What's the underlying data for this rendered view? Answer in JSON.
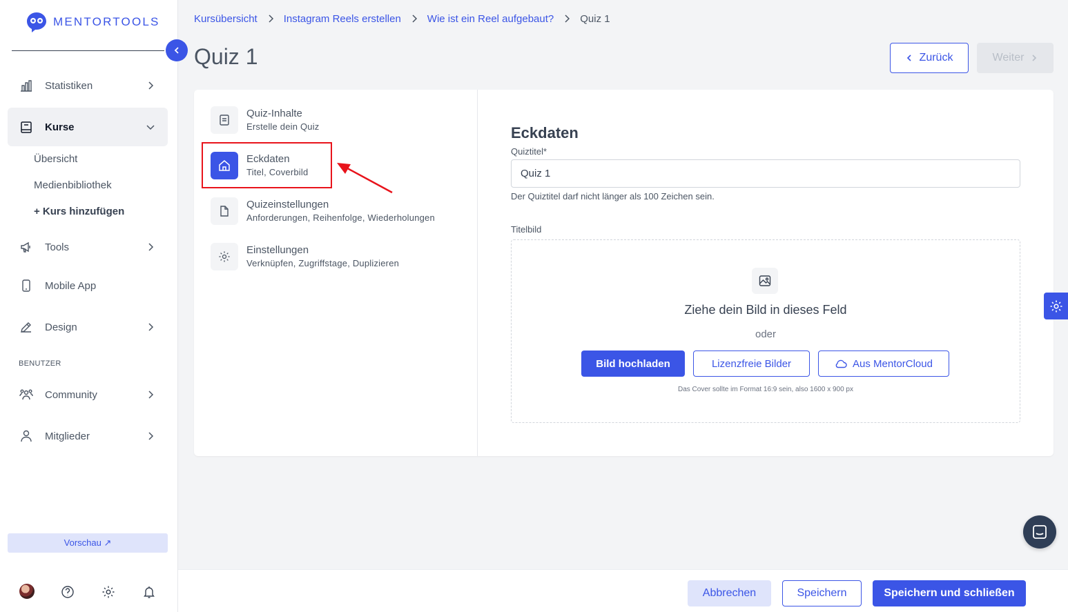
{
  "brand": {
    "name": "MENTORTOOLS",
    "accent": "#3b55e6"
  },
  "sidebar": {
    "nav": [
      {
        "label": "Statistiken",
        "icon": "bar-chart-icon"
      },
      {
        "label": "Kurse",
        "icon": "book-icon",
        "active": true
      },
      {
        "label": "Tools",
        "icon": "megaphone-icon"
      },
      {
        "label": "Mobile App",
        "icon": "phone-icon"
      },
      {
        "label": "Design",
        "icon": "pencil-icon"
      },
      {
        "label": "Community",
        "icon": "users-icon"
      },
      {
        "label": "Mitglieder",
        "icon": "user-icon"
      }
    ],
    "kurse_sub": [
      "Übersicht",
      "Medienbibliothek",
      "+ Kurs hinzufügen"
    ],
    "section_label": "BENUTZER",
    "preview_label": "Vorschau ↗"
  },
  "breadcrumb": [
    "Kursübersicht",
    "Instagram Reels erstellen",
    "Wie ist ein Reel aufgebaut?",
    "Quiz 1"
  ],
  "page_title": "Quiz 1",
  "nav_buttons": {
    "back": "Zurück",
    "next": "Weiter"
  },
  "steps": [
    {
      "title": "Quiz-Inhalte",
      "subtitle": "Erstelle dein Quiz",
      "icon": "document-list-icon"
    },
    {
      "title": "Eckdaten",
      "subtitle": "Titel, Coverbild",
      "icon": "home-icon",
      "active": true
    },
    {
      "title": "Quizeinstellungen",
      "subtitle": "Anforderungen, Reihenfolge, Wiederholungen",
      "icon": "file-icon"
    },
    {
      "title": "Einstellungen",
      "subtitle": "Verknüpfen, Zugriffstage, Duplizieren",
      "icon": "gear-icon"
    }
  ],
  "form": {
    "heading": "Eckdaten",
    "title_label": "Quiztitel*",
    "title_value": "Quiz 1",
    "title_hint": "Der Quiztitel darf nicht länger als 100 Zeichen sein.",
    "image_label": "Titelbild",
    "dropzone_title": "Ziehe dein Bild in dieses Feld",
    "dropzone_or": "oder",
    "upload_button": "Bild hochladen",
    "free_images_button": "Lizenzfreie Bilder",
    "mentorcloud_button": "Aus MentorCloud",
    "cover_note": "Das Cover sollte im Format 16:9 sein, also 1600 x 900 px"
  },
  "footer": {
    "cancel": "Abbrechen",
    "save": "Speichern",
    "save_close": "Speichern und schließen"
  }
}
